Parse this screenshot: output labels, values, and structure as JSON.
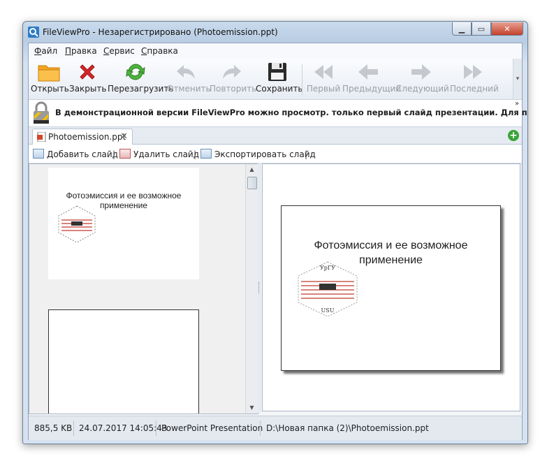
{
  "window": {
    "title": "FileViewPro - Незарегистрировано (Photoemission.ppt)"
  },
  "menu": {
    "items": [
      {
        "first": "Ф",
        "rest": "айл"
      },
      {
        "first": "П",
        "rest": "равка"
      },
      {
        "first": "С",
        "rest": "ервис"
      },
      {
        "first": "С",
        "rest": "правка"
      }
    ]
  },
  "toolbar": {
    "open": "Открыть",
    "close": "Закрыть",
    "reload": "Перезагрузить",
    "undo": "Отменить",
    "redo": "Повторить",
    "save": "Сохранить",
    "first": "Первый",
    "prev": "Предыдущий",
    "next": "Следующий",
    "last": "Последний"
  },
  "banner": {
    "text": "В демонстрационной версии FileViewPro можно просмотр. только первый слайд презентации. Для просмотра всех",
    "more": "»"
  },
  "tab": {
    "label": "Photoemission.ppt",
    "close": "✕",
    "add": "+"
  },
  "slide_toolbar": {
    "add": "Добавить слайд",
    "delete": "Удалить слайд",
    "export": "Экспортировать слайд",
    "sep": "|"
  },
  "slide": {
    "title_line1": "Фотоэмиссия и ее возможное",
    "title_line2": "применение",
    "logo_top": "УрГУ",
    "logo_bottom": "USU"
  },
  "status": {
    "size": "885,5 KB",
    "date": "24.07.2017 14:05:43",
    "type": "PowerPoint Presentation",
    "path": "D:\\Новая папка (2)\\Photoemission.ppt"
  },
  "colors": {
    "window_frame": "#b9cde3",
    "close_button": "#c4412b",
    "accent_green": "#3aa436",
    "accent_red": "#d6262b"
  }
}
